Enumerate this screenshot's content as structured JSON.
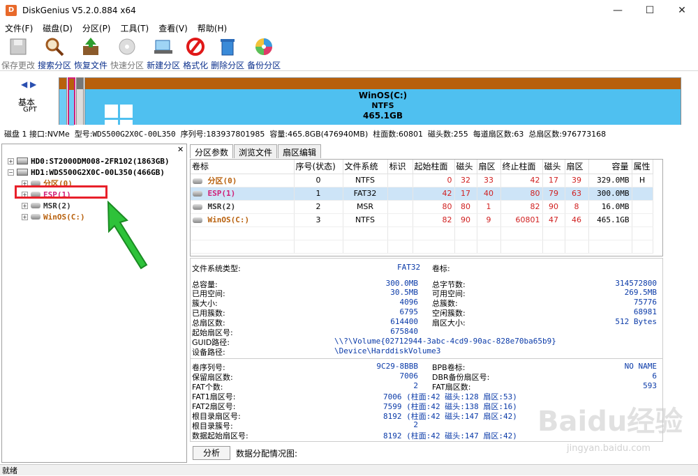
{
  "window": {
    "title": "DiskGenius V5.2.0.884 x64"
  },
  "menu": [
    "文件(F)",
    "磁盘(D)",
    "分区(P)",
    "工具(T)",
    "查看(V)",
    "帮助(H)"
  ],
  "toolbar": [
    {
      "label": "保存更改",
      "icon": "save-icon",
      "disabled": true
    },
    {
      "label": "搜索分区",
      "icon": "magnifier-icon",
      "disabled": false
    },
    {
      "label": "恢复文件",
      "icon": "recover-box-icon",
      "disabled": false
    },
    {
      "label": "快速分区",
      "icon": "quick-partition-icon",
      "disabled": true
    },
    {
      "label": "新建分区",
      "icon": "new-partition-icon",
      "disabled": false
    },
    {
      "label": "格式化",
      "icon": "format-icon",
      "disabled": false
    },
    {
      "label": "删除分区",
      "icon": "trash-icon",
      "disabled": false
    },
    {
      "label": "备份分区",
      "icon": "backup-disc-icon",
      "disabled": false
    }
  ],
  "diskbar": {
    "basic": "基本",
    "gpt": "GPT",
    "main_name": "WinOS(C:)",
    "main_fs": "NTFS",
    "main_size": "465.1GB",
    "colors": {
      "cap": "#b8600c",
      "body": "#4fc0f0",
      "esp_border": "#d0207a"
    }
  },
  "disk_info": {
    "disk": "磁盘 1 接口:NVMe",
    "model_label": "型号:",
    "model": "WDS500G2X0C-00L350",
    "serial_label": "序列号:",
    "serial": "183937801985",
    "capacity_label": "容量:",
    "capacity": "465.8GB(476940MB)",
    "cyl_label": "柱面数:",
    "cylinders": "60801",
    "heads_label": "磁头数:",
    "heads": "255",
    "spt_label": "每道扇区数:",
    "spt": "63",
    "total_label": "总扇区数:",
    "total": "976773168"
  },
  "tree": [
    {
      "label": "HD0:ST2000DM008-2FR102(1863GB)",
      "level": 0,
      "type": "disk",
      "color": "#000000"
    },
    {
      "label": "HD1:WDS500G2X0C-00L350(466GB)",
      "level": 0,
      "type": "disk",
      "color": "#000000"
    },
    {
      "label": "分区(0)",
      "level": 1,
      "type": "part",
      "color": "#b8600c"
    },
    {
      "label": "ESP(1)",
      "level": 1,
      "type": "part",
      "color": "#d02078"
    },
    {
      "label": "MSR(2)",
      "level": 1,
      "type": "part",
      "color": "#333333"
    },
    {
      "label": "WinOS(C:)",
      "level": 1,
      "type": "part",
      "color": "#b8600c"
    }
  ],
  "tabs": [
    "分区参数",
    "浏览文件",
    "扇区编辑"
  ],
  "table": {
    "headers": [
      "卷标",
      "序号(状态)",
      "文件系统",
      "标识",
      "起始柱面",
      "磁头",
      "扇区",
      "终止柱面",
      "磁头",
      "扇区",
      "容量",
      "属性"
    ],
    "rows": [
      {
        "name": "分区(0)",
        "color": "#b8600c",
        "cells": [
          "0",
          "NTFS",
          "",
          "0",
          "32",
          "33",
          "42",
          "17",
          "39",
          "329.0MB",
          "H"
        ]
      },
      {
        "name": "ESP(1)",
        "color": "#d02078",
        "cells": [
          "1",
          "FAT32",
          "",
          "42",
          "17",
          "40",
          "80",
          "79",
          "63",
          "300.0MB",
          ""
        ]
      },
      {
        "name": "MSR(2)",
        "color": "#333333",
        "cells": [
          "2",
          "MSR",
          "",
          "80",
          "80",
          "1",
          "82",
          "90",
          "8",
          "16.0MB",
          ""
        ]
      },
      {
        "name": "WinOS(C:)",
        "color": "#b8600c",
        "cells": [
          "3",
          "NTFS",
          "",
          "82",
          "90",
          "9",
          "60801",
          "47",
          "46",
          "465.1GB",
          ""
        ]
      }
    ]
  },
  "info": {
    "fs_type_label": "文件系统类型:",
    "fs_type": "FAT32",
    "volume_label": "卷标:",
    "left1": [
      [
        "总容量:",
        "300.0MB"
      ],
      [
        "已用空间:",
        "30.5MB"
      ],
      [
        "簇大小:",
        "4096"
      ],
      [
        "已用簇数:",
        "6795"
      ],
      [
        "总扇区数:",
        "614400"
      ],
      [
        "起始扇区号:",
        "675840"
      ]
    ],
    "right1": [
      [
        "总字节数:",
        "314572800"
      ],
      [
        "可用空间:",
        "269.5MB"
      ],
      [
        "总簇数:",
        "75776"
      ],
      [
        "空闲簇数:",
        "68981"
      ],
      [
        "扇区大小:",
        "512 Bytes"
      ]
    ],
    "guid_label": "GUID路径:",
    "guid": "\\\\?\\Volume{02712944-3abc-4cd9-90ac-828e70ba65b9}",
    "device_label": "设备路径:",
    "device": "\\Device\\HarddiskVolume3",
    "left2": [
      [
        "卷序列号:",
        "9C29-8BBB"
      ],
      [
        "保留扇区数:",
        "7006"
      ],
      [
        "FAT个数:",
        "2"
      ],
      [
        "FAT1扇区号:",
        "7006 (柱面:42 磁头:128 扇区:53)"
      ],
      [
        "FAT2扇区号:",
        "7599 (柱面:42 磁头:138 扇区:16)"
      ],
      [
        "根目录扇区号:",
        "8192 (柱面:42 磁头:147 扇区:42)"
      ],
      [
        "根目录簇号:",
        "2"
      ],
      [
        "数据起始扇区号:",
        "8192 (柱面:42 磁头:147 扇区:42)"
      ]
    ],
    "right2": [
      [
        "BPB卷标:",
        "NO NAME"
      ],
      [
        "DBR备份扇区号:",
        "6"
      ],
      [
        "FAT扇区数:",
        "593"
      ]
    ]
  },
  "analyze_button": "分析",
  "alloc_label": "数据分配情况图:",
  "status": "就绪",
  "watermark": {
    "main": "Baidu经验",
    "sub": "jingyan.baidu.com"
  }
}
